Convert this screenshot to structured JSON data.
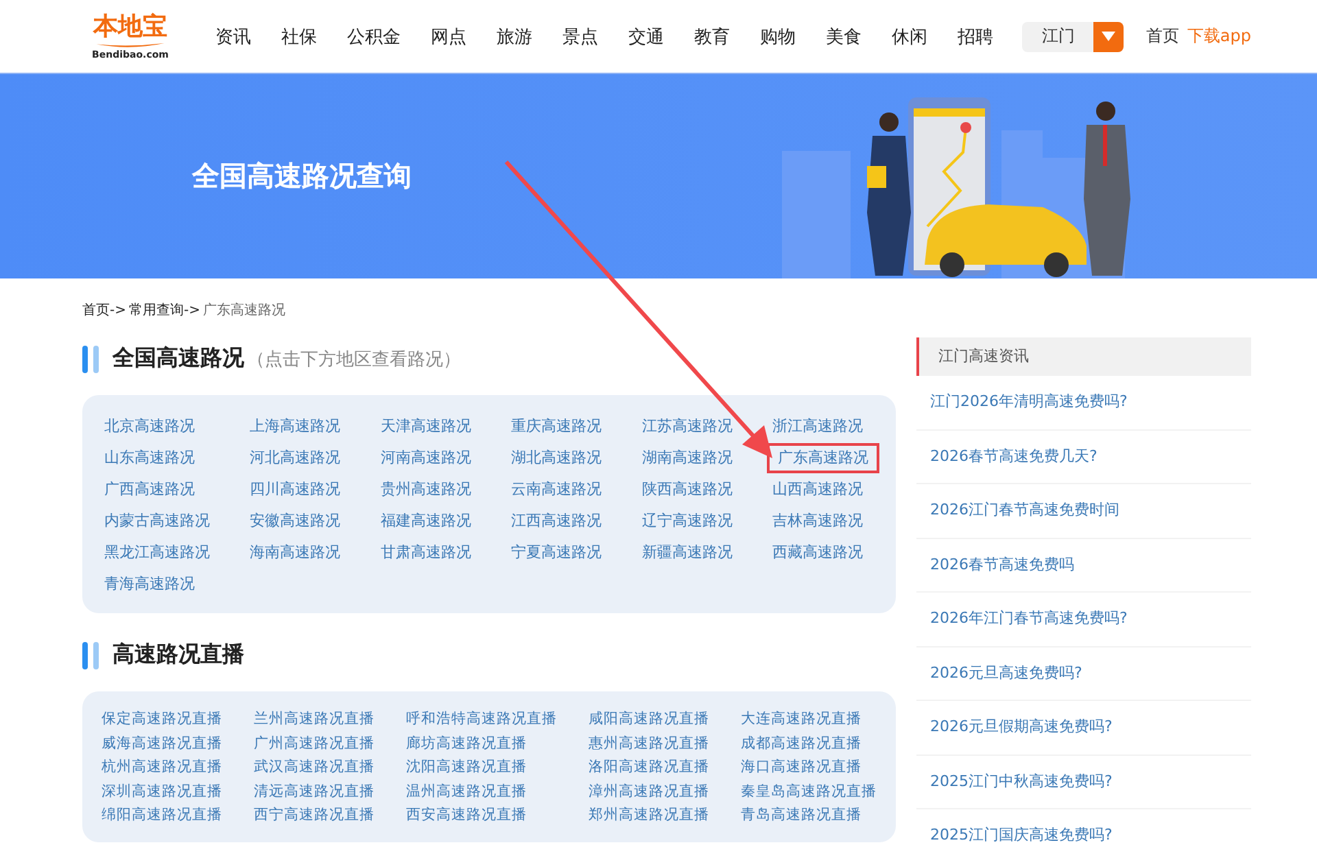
{
  "header": {
    "logo": {
      "name": "本地宝",
      "domain": "Bendibao.com"
    },
    "nav": [
      "资讯",
      "社保",
      "公积金",
      "网点",
      "旅游",
      "景点",
      "交通",
      "教育",
      "购物",
      "美食",
      "休闲",
      "招聘"
    ],
    "city": "江门",
    "links": [
      {
        "label": "首页",
        "kind": "plain"
      },
      {
        "label": "下载app",
        "kind": "accent"
      }
    ]
  },
  "banner": {
    "title": "全国高速路况查询"
  },
  "breadcrumb": [
    {
      "label": "首页->",
      "kind": "link"
    },
    {
      "label": "常用查询->",
      "kind": "link"
    },
    {
      "label": "广东高速路况",
      "kind": "current"
    }
  ],
  "provinces": {
    "title": "全国高速路况",
    "hint": "（点击下方地区查看路况）",
    "items": [
      {
        "label": "北京高速路况",
        "highlighted": false
      },
      {
        "label": "上海高速路况",
        "highlighted": false
      },
      {
        "label": "天津高速路况",
        "highlighted": false
      },
      {
        "label": "重庆高速路况",
        "highlighted": false
      },
      {
        "label": "江苏高速路况",
        "highlighted": false
      },
      {
        "label": "浙江高速路况",
        "highlighted": false
      },
      {
        "label": "山东高速路况",
        "highlighted": false
      },
      {
        "label": "河北高速路况",
        "highlighted": false
      },
      {
        "label": "河南高速路况",
        "highlighted": false
      },
      {
        "label": "湖北高速路况",
        "highlighted": false
      },
      {
        "label": "湖南高速路况",
        "highlighted": false
      },
      {
        "label": "广东高速路况",
        "highlighted": true
      },
      {
        "label": "广西高速路况",
        "highlighted": false
      },
      {
        "label": "四川高速路况",
        "highlighted": false
      },
      {
        "label": "贵州高速路况",
        "highlighted": false
      },
      {
        "label": "云南高速路况",
        "highlighted": false
      },
      {
        "label": "陕西高速路况",
        "highlighted": false
      },
      {
        "label": "山西高速路况",
        "highlighted": false
      },
      {
        "label": "内蒙古高速路况",
        "highlighted": false
      },
      {
        "label": "安徽高速路况",
        "highlighted": false
      },
      {
        "label": "福建高速路况",
        "highlighted": false
      },
      {
        "label": "江西高速路况",
        "highlighted": false
      },
      {
        "label": "辽宁高速路况",
        "highlighted": false
      },
      {
        "label": "吉林高速路况",
        "highlighted": false
      },
      {
        "label": "黑龙江高速路况",
        "highlighted": false
      },
      {
        "label": "海南高速路况",
        "highlighted": false
      },
      {
        "label": "甘肃高速路况",
        "highlighted": false
      },
      {
        "label": "宁夏高速路况",
        "highlighted": false
      },
      {
        "label": "新疆高速路况",
        "highlighted": false
      },
      {
        "label": "西藏高速路况",
        "highlighted": false
      },
      {
        "label": "青海高速路况",
        "highlighted": false
      }
    ]
  },
  "live": {
    "title": "高速路况直播",
    "items": [
      "保定高速路况直播",
      "兰州高速路况直播",
      "呼和浩特高速路况直播",
      "咸阳高速路况直播",
      "大连高速路况直播",
      "威海高速路况直播",
      "广州高速路况直播",
      "廊坊高速路况直播",
      "惠州高速路况直播",
      "成都高速路况直播",
      "杭州高速路况直播",
      "武汉高速路况直播",
      "沈阳高速路况直播",
      "洛阳高速路况直播",
      "海口高速路况直播",
      "深圳高速路况直播",
      "清远高速路况直播",
      "温州高速路况直播",
      "漳州高速路况直播",
      "秦皇岛高速路况直播",
      "绵阳高速路况直播",
      "西宁高速路况直播",
      "西安高速路况直播",
      "郑州高速路况直播",
      "青岛高速路况直播"
    ]
  },
  "sidebar": {
    "title": "江门高速资讯",
    "items": [
      "江门2026年清明高速免费吗?",
      "2026春节高速免费几天?",
      "2026江门春节高速免费时间",
      "2026春节高速免费吗",
      "2026年江门春节高速免费吗?",
      "2026元旦高速免费吗?",
      "2026元旦假期高速免费吗?",
      "2025江门中秋高速免费吗?",
      "2025江门国庆高速免费吗?"
    ]
  }
}
